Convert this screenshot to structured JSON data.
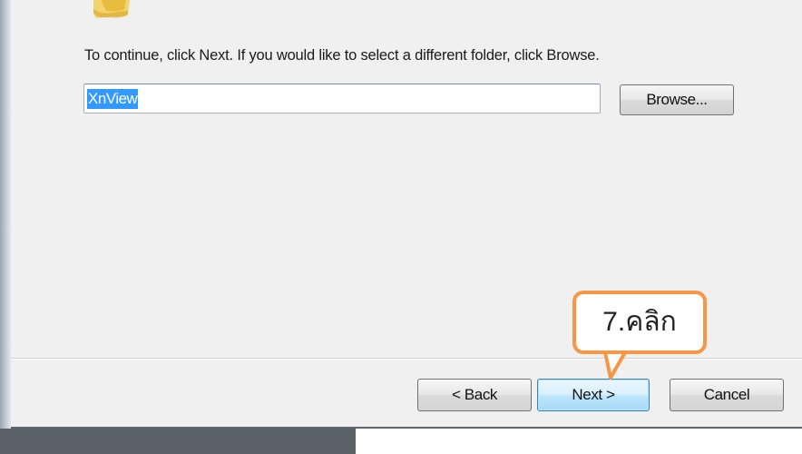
{
  "dialog": {
    "instruction": "To continue, click Next. If you would like to select a different folder, click Browse.",
    "folder_value": "XnView",
    "browse_label": "Browse...",
    "back_label": "< Back",
    "next_label": "Next >",
    "cancel_label": "Cancel"
  },
  "annotation": {
    "callout_text": "7.คลิก",
    "callout_color": "#f79646"
  },
  "icons": {
    "folder": "folder-icon"
  }
}
